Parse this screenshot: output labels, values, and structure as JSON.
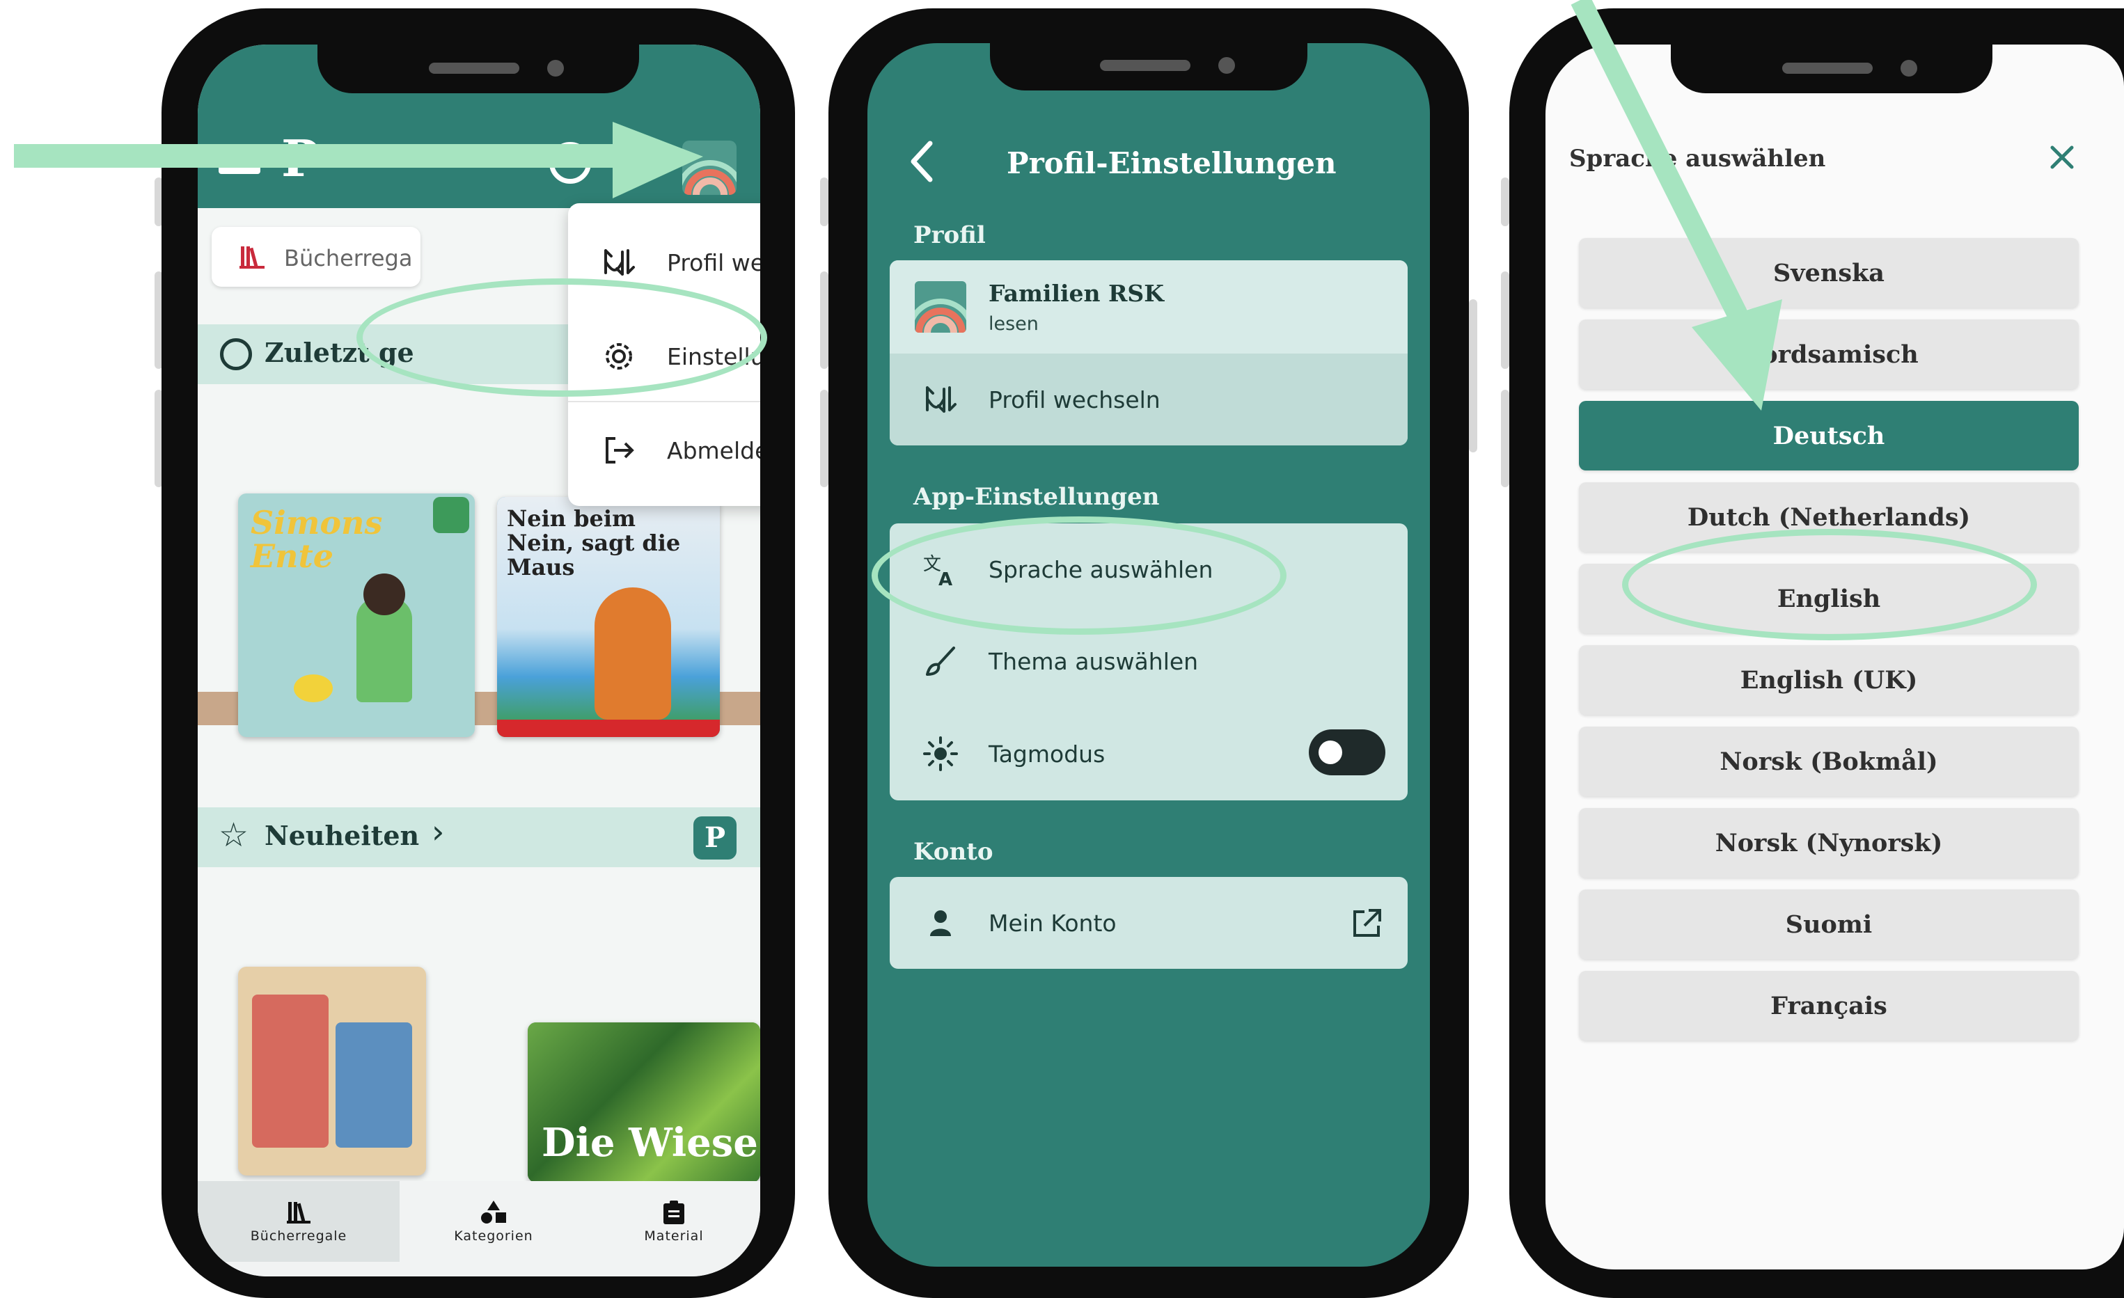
{
  "colors": {
    "teal": "#2f7f74",
    "mint_light": "#cfe8e1",
    "highlight": "#a6e4c0",
    "selected_language": "#2f7f74"
  },
  "phone1": {
    "search_placeholder": "Bücherrega",
    "recent_label": "Zuletzt ge",
    "new_section": "Neuheiten",
    "new_badge": "P",
    "book_simon_title": "Simons Ente",
    "book_nein_title": "Nein beim Nein, sagt die Maus",
    "book_wiese_title": "Die Wiese",
    "menu": {
      "switch_profile": "Profil wechseln",
      "settings": "Einstellungen",
      "logout": "Abmelden"
    },
    "nav": {
      "shelves": "Bücherregale",
      "categories": "Kategorien",
      "material": "Material"
    }
  },
  "phone2": {
    "title": "Profil-Einstellungen",
    "section_profile": "Profil",
    "profile_name": "Familien RSK",
    "profile_role": "lesen",
    "switch_profile": "Profil wechseln",
    "section_app": "App-Einstellungen",
    "language": "Sprache auswählen",
    "theme": "Thema auswählen",
    "day_mode": "Tagmodus",
    "day_mode_on": false,
    "section_account": "Konto",
    "my_account": "Mein Konto"
  },
  "phone3": {
    "title": "Sprache auswählen",
    "languages": [
      "Svenska",
      "Nordsamisch",
      "Deutsch",
      "Dutch (Netherlands)",
      "English",
      "English (UK)",
      "Norsk (Bokmål)",
      "Norsk (Nynorsk)",
      "Suomi",
      "Français"
    ],
    "selected": "Deutsch"
  }
}
